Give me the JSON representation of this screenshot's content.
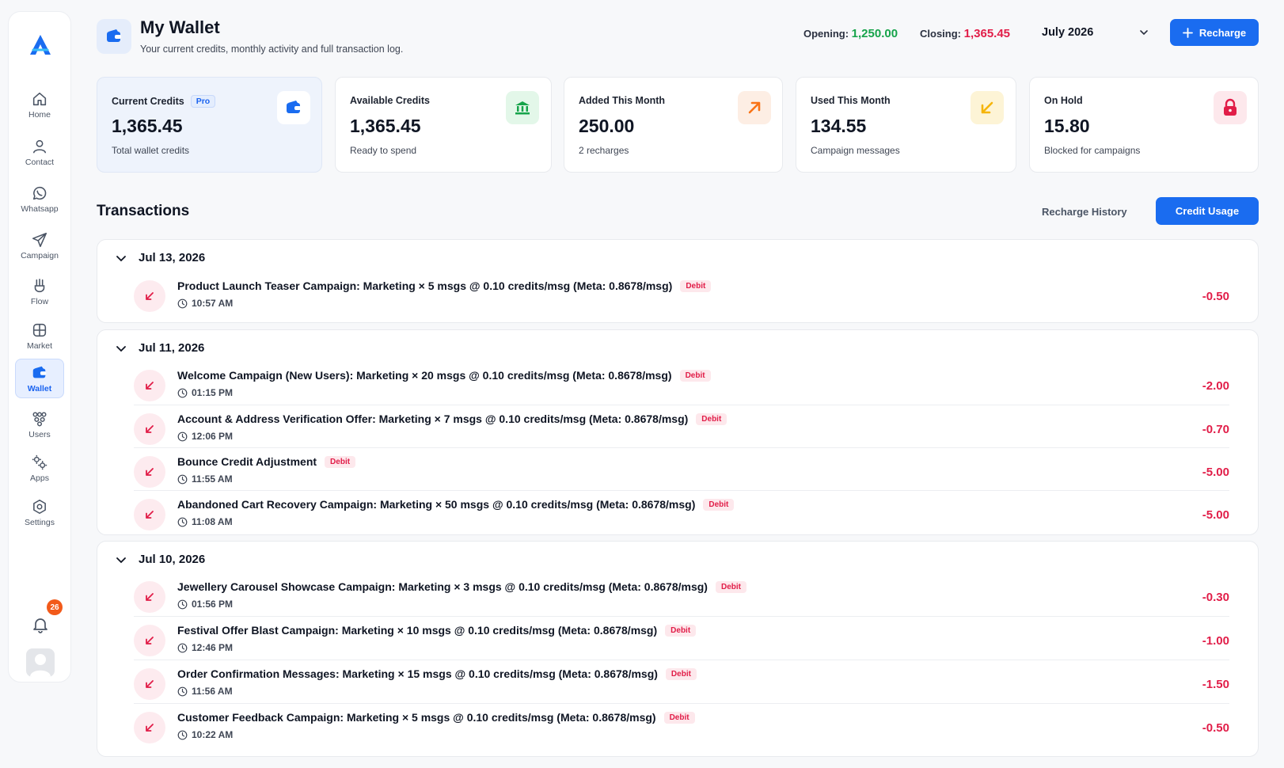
{
  "sidebar": {
    "items": [
      {
        "label": "Home",
        "icon": "home-icon"
      },
      {
        "label": "Contact",
        "icon": "user-icon"
      },
      {
        "label": "Whatsapp",
        "icon": "whatsapp-icon"
      },
      {
        "label": "Campaign",
        "icon": "send-icon"
      },
      {
        "label": "Flow",
        "icon": "flow-icon"
      },
      {
        "label": "Market",
        "icon": "store-icon"
      },
      {
        "label": "Wallet",
        "icon": "wallet-icon",
        "active": true
      },
      {
        "label": "Users",
        "icon": "users-icon"
      },
      {
        "label": "Apps",
        "icon": "apps-icon"
      },
      {
        "label": "Settings",
        "icon": "gear-icon"
      }
    ],
    "notifications": "26"
  },
  "header": {
    "title": "My Wallet",
    "subtitle": "Your current credits, monthly activity and full transaction log.",
    "opening_label": "Opening:",
    "opening_value": "1,250.00",
    "closing_label": "Closing:",
    "closing_value": "1,365.45",
    "month": "July 2026",
    "recharge_label": "Recharge"
  },
  "cards": [
    {
      "label": "Current Credits",
      "badge": "Pro",
      "value": "1,365.45",
      "note": "Total wallet credits",
      "icon": "wallet-icon"
    },
    {
      "label": "Available Credits",
      "value": "1,365.45",
      "note": "Ready to spend",
      "icon": "bank-icon"
    },
    {
      "label": "Added This Month",
      "value": "250.00",
      "note": "2 recharges",
      "icon": "arrow-up-right-icon"
    },
    {
      "label": "Used This Month",
      "value": "134.55",
      "note": "Campaign messages",
      "icon": "arrow-down-left-icon"
    },
    {
      "label": "On Hold",
      "value": "15.80",
      "note": "Blocked for campaigns",
      "icon": "lock-icon"
    }
  ],
  "transactions": {
    "title": "Transactions",
    "tab_history": "Recharge History",
    "tab_usage": "Credit Usage",
    "debit_label": "Debit",
    "groups": [
      {
        "date": "Jul 13, 2026",
        "rows": [
          {
            "desc": "Product Launch Teaser Campaign: Marketing × 5 msgs @ 0.10 credits/msg (Meta: 0.8678/msg)",
            "time": "10:57 AM",
            "amount": "-0.50"
          }
        ]
      },
      {
        "date": "Jul 11, 2026",
        "rows": [
          {
            "desc": "Welcome Campaign (New Users): Marketing × 20 msgs @ 0.10 credits/msg (Meta: 0.8678/msg)",
            "time": "01:15 PM",
            "amount": "-2.00"
          },
          {
            "desc": "Account & Address Verification Offer: Marketing × 7 msgs @ 0.10 credits/msg (Meta: 0.8678/msg)",
            "time": "12:06 PM",
            "amount": "-0.70"
          },
          {
            "desc": "Bounce Credit Adjustment",
            "time": "11:55 AM",
            "amount": "-5.00"
          },
          {
            "desc": "Abandoned Cart Recovery Campaign: Marketing × 50 msgs @ 0.10 credits/msg (Meta: 0.8678/msg)",
            "time": "11:08 AM",
            "amount": "-5.00"
          }
        ]
      },
      {
        "date": "Jul 10, 2026",
        "rows": [
          {
            "desc": "Jewellery Carousel Showcase Campaign: Marketing × 3 msgs @ 0.10 credits/msg (Meta: 0.8678/msg)",
            "time": "01:56 PM",
            "amount": "-0.30"
          },
          {
            "desc": "Festival Offer Blast Campaign: Marketing × 10 msgs @ 0.10 credits/msg (Meta: 0.8678/msg)",
            "time": "12:46 PM",
            "amount": "-1.00"
          },
          {
            "desc": "Order Confirmation Messages: Marketing × 15 msgs @ 0.10 credits/msg (Meta: 0.8678/msg)",
            "time": "11:56 AM",
            "amount": "-1.50"
          },
          {
            "desc": "Customer Feedback Campaign: Marketing × 5 msgs @ 0.10 credits/msg (Meta: 0.8678/msg)",
            "time": "10:22 AM",
            "amount": "-0.50"
          }
        ]
      }
    ]
  },
  "colors": {
    "accent": "#1a6cf0",
    "positive": "#16a34a",
    "negative": "#e11d48",
    "orange": "#f97316",
    "amber": "#f5b50a"
  }
}
